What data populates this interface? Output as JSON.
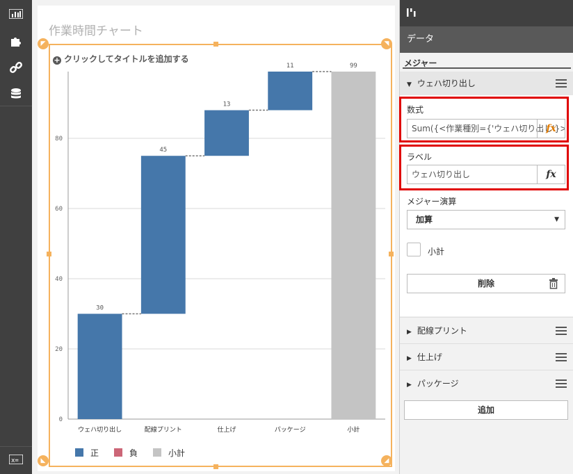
{
  "sidebar": {
    "icons": [
      "bar-chart-icon",
      "puzzle-icon",
      "link-icon",
      "database-icon",
      "variable-icon"
    ]
  },
  "chart": {
    "title": "作業時間チャート",
    "add_title": "クリックしてタイトルを追加する"
  },
  "chart_data": {
    "type": "bar",
    "subtype": "waterfall",
    "categories": [
      "ウェハ切り出し",
      "配線プリント",
      "仕上げ",
      "パッケージ",
      "小計"
    ],
    "values": [
      30,
      45,
      13,
      11,
      99
    ],
    "bar_starts": [
      0,
      30,
      75,
      88,
      0
    ],
    "bar_kinds": [
      "positive",
      "positive",
      "positive",
      "positive",
      "subtotal"
    ],
    "data_labels": [
      "30",
      "45",
      "13",
      "11",
      "99"
    ],
    "ylim": [
      0,
      99
    ],
    "yticks": [
      "0",
      "20",
      "40",
      "60",
      "80"
    ],
    "ytick_values": [
      0,
      20,
      40,
      60,
      80
    ],
    "grid": true,
    "legend_position": "bottom-left",
    "legend": [
      "正",
      "負",
      "小計"
    ],
    "colors": {
      "positive": "#4577aa",
      "negative": "#cc6677",
      "subtotal": "#c4c4c4"
    }
  },
  "panel": {
    "tab_label": "データ",
    "section_label": "メジャー",
    "measure_name": "ウェハ切り出し",
    "expression_label": "数式",
    "expression_value": "Sum({<作業種別={'ウェハ切り出し'}>}",
    "label_label": "ラベル",
    "label_value": "ウェハ切り出し",
    "fx": "fx",
    "calc_label": "メジャー演算",
    "calc_value": "加算",
    "subtotal_label": "小計",
    "delete_label": "削除",
    "other_measures": [
      "配線プリント",
      "仕上げ",
      "パッケージ"
    ],
    "add_label": "追加"
  },
  "accent": "#f5b25d",
  "highlight": "#e00000"
}
